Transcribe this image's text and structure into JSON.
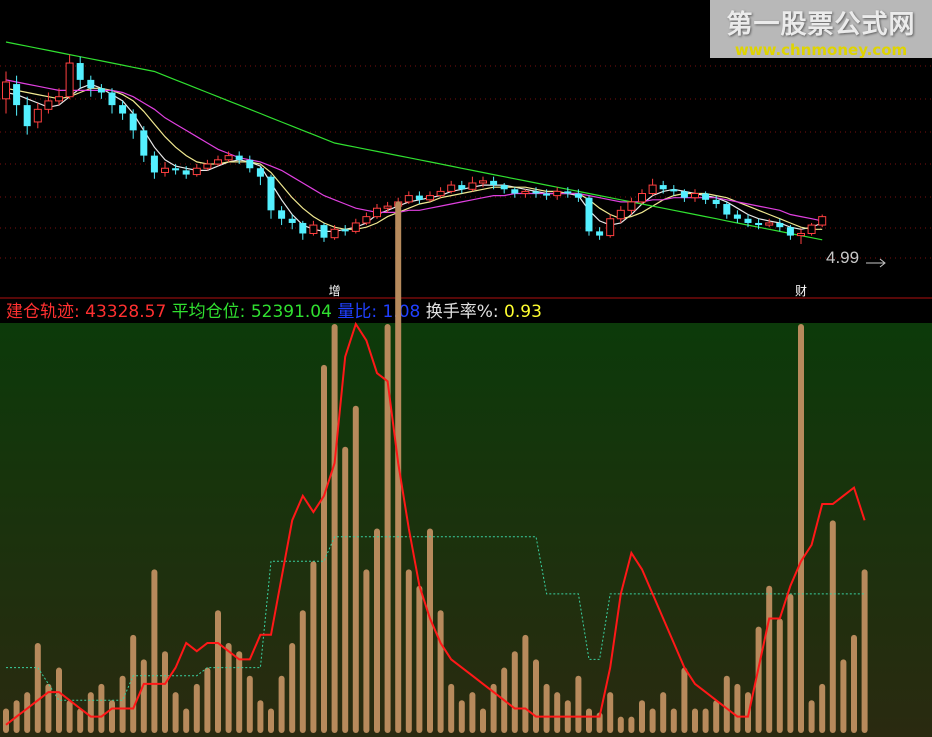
{
  "watermark": {
    "title": "第一股票公式网",
    "url": "www.chnmoney.com"
  },
  "colors": {
    "bg": "#000000",
    "grid": "#7a1010",
    "up": "#ff4040",
    "down": "#54f0ff",
    "ma_white": "#e8e8e8",
    "ma_yellow": "#f0e890",
    "ma_magenta": "#e040e0",
    "ma_green": "#30e030",
    "vol_bar": "#b78a5c",
    "red_line": "#ff1818",
    "dot_line": "#3ad0a0",
    "lower_bg_top": "#0c3a0a",
    "lower_bg_bottom": "#2a2a10"
  },
  "indicator_bar": [
    {
      "label": "建仓轨迹:",
      "value": "43328.57",
      "label_color": "#ff3030",
      "value_color": "#ff3030"
    },
    {
      "label": "平均仓位:",
      "value": "52391.04",
      "label_color": "#30e030",
      "value_color": "#30e030"
    },
    {
      "label": "量比:",
      "value": "1.08",
      "label_color": "#2040ff",
      "value_color": "#2040ff"
    },
    {
      "label": "换手率%:",
      "value": "0.93",
      "label_color": "#e0e0e0",
      "value_color": "#ffff30"
    }
  ],
  "chart_data": [
    {
      "type": "candlestick",
      "price_annotation": "4.99",
      "event_markers": [
        {
          "index": 31,
          "label": "增"
        },
        {
          "index": 75,
          "label": "财"
        }
      ],
      "candles": [
        [
          5.55,
          5.63,
          5.68,
          5.48
        ],
        [
          5.62,
          5.52,
          5.66,
          5.47
        ],
        [
          5.52,
          5.42,
          5.56,
          5.38
        ],
        [
          5.44,
          5.5,
          5.53,
          5.41
        ],
        [
          5.5,
          5.54,
          5.58,
          5.48
        ],
        [
          5.54,
          5.56,
          5.6,
          5.52
        ],
        [
          5.56,
          5.72,
          5.76,
          5.55
        ],
        [
          5.72,
          5.64,
          5.75,
          5.6
        ],
        [
          5.64,
          5.6,
          5.66,
          5.56
        ],
        [
          5.6,
          5.58,
          5.62,
          5.55
        ],
        [
          5.58,
          5.52,
          5.6,
          5.48
        ],
        [
          5.52,
          5.48,
          5.54,
          5.45
        ],
        [
          5.48,
          5.4,
          5.5,
          5.36
        ],
        [
          5.4,
          5.28,
          5.42,
          5.25
        ],
        [
          5.28,
          5.2,
          5.3,
          5.17
        ],
        [
          5.2,
          5.22,
          5.25,
          5.18
        ],
        [
          5.22,
          5.21,
          5.24,
          5.19
        ],
        [
          5.21,
          5.19,
          5.23,
          5.17
        ],
        [
          5.19,
          5.22,
          5.24,
          5.18
        ],
        [
          5.22,
          5.24,
          5.26,
          5.21
        ],
        [
          5.24,
          5.26,
          5.28,
          5.23
        ],
        [
          5.26,
          5.28,
          5.3,
          5.25
        ],
        [
          5.28,
          5.26,
          5.3,
          5.24
        ],
        [
          5.26,
          5.22,
          5.28,
          5.2
        ],
        [
          5.22,
          5.18,
          5.23,
          5.14
        ],
        [
          5.18,
          5.02,
          5.19,
          4.98
        ],
        [
          5.02,
          4.98,
          5.04,
          4.95
        ],
        [
          4.98,
          4.96,
          5.0,
          4.93
        ],
        [
          4.96,
          4.91,
          4.97,
          4.88
        ],
        [
          4.91,
          4.95,
          4.97,
          4.9
        ],
        [
          4.95,
          4.89,
          4.96,
          4.87
        ],
        [
          4.89,
          4.93,
          4.95,
          4.88
        ],
        [
          4.93,
          4.92,
          4.95,
          4.9
        ],
        [
          4.92,
          4.96,
          4.98,
          4.91
        ],
        [
          4.96,
          4.99,
          5.01,
          4.95
        ],
        [
          4.99,
          5.03,
          5.05,
          4.98
        ],
        [
          5.03,
          5.04,
          5.06,
          5.01
        ],
        [
          5.04,
          5.06,
          5.08,
          5.03
        ],
        [
          5.06,
          5.09,
          5.11,
          5.05
        ],
        [
          5.09,
          5.07,
          5.11,
          5.05
        ],
        [
          5.07,
          5.09,
          5.11,
          5.06
        ],
        [
          5.09,
          5.11,
          5.13,
          5.08
        ],
        [
          5.11,
          5.14,
          5.16,
          5.1
        ],
        [
          5.14,
          5.12,
          5.16,
          5.1
        ],
        [
          5.12,
          5.15,
          5.18,
          5.11
        ],
        [
          5.15,
          5.16,
          5.18,
          5.13
        ],
        [
          5.16,
          5.14,
          5.18,
          5.12
        ],
        [
          5.14,
          5.12,
          5.15,
          5.1
        ],
        [
          5.12,
          5.1,
          5.13,
          5.08
        ],
        [
          5.1,
          5.11,
          5.12,
          5.08
        ],
        [
          5.11,
          5.1,
          5.13,
          5.08
        ],
        [
          5.1,
          5.09,
          5.12,
          5.07
        ],
        [
          5.09,
          5.11,
          5.13,
          5.07
        ],
        [
          5.11,
          5.1,
          5.13,
          5.08
        ],
        [
          5.1,
          5.08,
          5.12,
          5.06
        ],
        [
          5.08,
          4.92,
          5.09,
          4.9
        ],
        [
          4.92,
          4.9,
          4.94,
          4.88
        ],
        [
          4.9,
          4.98,
          5.0,
          4.89
        ],
        [
          4.98,
          5.02,
          5.04,
          4.96
        ],
        [
          5.02,
          5.06,
          5.08,
          5.0
        ],
        [
          5.06,
          5.1,
          5.12,
          5.05
        ],
        [
          5.1,
          5.14,
          5.17,
          5.09
        ],
        [
          5.14,
          5.12,
          5.16,
          5.1
        ],
        [
          5.12,
          5.11,
          5.14,
          5.09
        ],
        [
          5.11,
          5.08,
          5.12,
          5.06
        ],
        [
          5.08,
          5.1,
          5.12,
          5.06
        ],
        [
          5.1,
          5.07,
          5.11,
          5.05
        ],
        [
          5.07,
          5.05,
          5.09,
          5.03
        ],
        [
          5.05,
          5.0,
          5.06,
          4.98
        ],
        [
          5.0,
          4.98,
          5.02,
          4.96
        ],
        [
          4.98,
          4.96,
          5.0,
          4.94
        ],
        [
          4.96,
          4.95,
          4.98,
          4.93
        ],
        [
          4.95,
          4.96,
          4.98,
          4.94
        ],
        [
          4.96,
          4.94,
          4.98,
          4.92
        ],
        [
          4.94,
          4.9,
          4.95,
          4.88
        ],
        [
          4.9,
          4.91,
          4.93,
          4.86
        ],
        [
          4.91,
          4.95,
          4.96,
          4.9
        ],
        [
          4.95,
          4.99,
          5.0,
          4.94
        ]
      ],
      "moving_averages": [
        {
          "color": "#e8e8e8",
          "values": [
            5.58,
            5.57,
            5.55,
            5.53,
            5.51,
            5.52,
            5.56,
            5.6,
            5.62,
            5.6,
            5.57,
            5.54,
            5.48,
            5.4,
            5.32,
            5.26,
            5.23,
            5.22,
            5.21,
            5.21,
            5.23,
            5.25,
            5.26,
            5.25,
            5.23,
            5.15,
            5.07,
            5.0,
            4.95,
            4.93,
            4.92,
            4.92,
            4.93,
            4.94,
            4.96,
            5.0,
            5.02,
            5.04,
            5.06,
            5.07,
            5.08,
            5.09,
            5.11,
            5.12,
            5.13,
            5.14,
            5.14,
            5.14,
            5.13,
            5.12,
            5.11,
            5.1,
            5.1,
            5.1,
            5.09,
            5.02,
            4.97,
            4.95,
            4.96,
            5.0,
            5.05,
            5.09,
            5.11,
            5.12,
            5.11,
            5.1,
            5.09,
            5.08,
            5.06,
            5.03,
            5.0,
            4.98,
            4.97,
            4.96,
            4.94,
            4.93,
            4.94,
            4.96
          ]
        },
        {
          "color": "#f0e890",
          "values": [
            5.6,
            5.59,
            5.58,
            5.57,
            5.56,
            5.55,
            5.56,
            5.58,
            5.6,
            5.6,
            5.59,
            5.57,
            5.54,
            5.49,
            5.43,
            5.37,
            5.32,
            5.28,
            5.25,
            5.24,
            5.24,
            5.25,
            5.25,
            5.25,
            5.24,
            5.2,
            5.14,
            5.08,
            5.03,
            4.99,
            4.96,
            4.94,
            4.93,
            4.93,
            4.94,
            4.96,
            4.99,
            5.01,
            5.03,
            5.05,
            5.06,
            5.08,
            5.09,
            5.1,
            5.11,
            5.12,
            5.13,
            5.13,
            5.13,
            5.13,
            5.12,
            5.11,
            5.11,
            5.1,
            5.1,
            5.07,
            5.03,
            5.0,
            4.98,
            4.99,
            5.01,
            5.04,
            5.07,
            5.09,
            5.1,
            5.1,
            5.1,
            5.09,
            5.08,
            5.06,
            5.04,
            5.02,
            5.0,
            4.98,
            4.96,
            4.94,
            4.93,
            4.93
          ]
        },
        {
          "color": "#e040e0",
          "values": [
            5.64,
            5.63,
            5.62,
            5.61,
            5.6,
            5.59,
            5.59,
            5.59,
            5.59,
            5.59,
            5.59,
            5.58,
            5.56,
            5.53,
            5.5,
            5.46,
            5.43,
            5.4,
            5.37,
            5.34,
            5.31,
            5.29,
            5.27,
            5.26,
            5.25,
            5.23,
            5.21,
            5.18,
            5.15,
            5.12,
            5.09,
            5.07,
            5.05,
            5.03,
            5.02,
            5.01,
            5.01,
            5.01,
            5.02,
            5.02,
            5.03,
            5.04,
            5.05,
            5.06,
            5.07,
            5.08,
            5.09,
            5.09,
            5.1,
            5.1,
            5.1,
            5.1,
            5.1,
            5.1,
            5.1,
            5.09,
            5.08,
            5.07,
            5.06,
            5.06,
            5.06,
            5.07,
            5.07,
            5.08,
            5.08,
            5.08,
            5.08,
            5.08,
            5.07,
            5.06,
            5.05,
            5.04,
            5.03,
            5.02,
            5.0,
            4.99,
            4.98,
            4.97
          ]
        },
        {
          "color": "#30e030",
          "values": [
            5.82,
            5.81,
            5.8,
            5.79,
            5.78,
            5.77,
            5.76,
            5.75,
            5.74,
            5.73,
            5.72,
            5.71,
            5.7,
            5.69,
            5.68,
            5.66,
            5.64,
            5.62,
            5.6,
            5.58,
            5.56,
            5.54,
            5.52,
            5.5,
            5.48,
            5.46,
            5.44,
            5.42,
            5.4,
            5.38,
            5.36,
            5.34,
            5.33,
            5.32,
            5.31,
            5.3,
            5.29,
            5.28,
            5.27,
            5.26,
            5.25,
            5.24,
            5.23,
            5.22,
            5.21,
            5.2,
            5.19,
            5.18,
            5.17,
            5.16,
            5.15,
            5.14,
            5.13,
            5.12,
            5.11,
            5.1,
            5.09,
            5.08,
            5.07,
            5.06,
            5.05,
            5.04,
            5.03,
            5.02,
            5.01,
            5.0,
            4.99,
            4.98,
            4.97,
            4.96,
            4.95,
            4.94,
            4.93,
            4.92,
            4.91,
            4.9,
            4.89,
            4.88
          ]
        }
      ]
    },
    {
      "type": "bar+line",
      "volume_bars": [
        6,
        8,
        10,
        22,
        12,
        16,
        8,
        6,
        10,
        12,
        8,
        14,
        24,
        18,
        40,
        20,
        10,
        6,
        12,
        16,
        30,
        22,
        20,
        14,
        8,
        6,
        14,
        22,
        30,
        42,
        90,
        100,
        70,
        80,
        40,
        50,
        100,
        130,
        40,
        36,
        50,
        30,
        12,
        8,
        10,
        6,
        12,
        16,
        20,
        24,
        18,
        12,
        10,
        8,
        14,
        6,
        5,
        10,
        4,
        4,
        8,
        6,
        10,
        6,
        16,
        6,
        6,
        8,
        14,
        12,
        10,
        26,
        36,
        28,
        34,
        100,
        8,
        12,
        52,
        18,
        24,
        40
      ],
      "red_line": [
        2,
        4,
        6,
        8,
        10,
        10,
        8,
        6,
        4,
        4,
        6,
        6,
        6,
        12,
        12,
        12,
        16,
        22,
        20,
        22,
        22,
        20,
        18,
        18,
        24,
        24,
        38,
        52,
        58,
        54,
        58,
        66,
        92,
        100,
        96,
        88,
        86,
        66,
        50,
        36,
        28,
        22,
        18,
        16,
        14,
        12,
        10,
        8,
        6,
        6,
        4,
        4,
        4,
        4,
        4,
        4,
        4,
        16,
        34,
        44,
        40,
        34,
        28,
        22,
        16,
        12,
        10,
        8,
        6,
        4,
        4,
        16,
        28,
        28,
        36,
        42,
        46,
        56,
        56,
        58,
        60,
        52
      ],
      "dotted_line": [
        16,
        16,
        16,
        16,
        12,
        8,
        8,
        8,
        8,
        8,
        8,
        8,
        14,
        14,
        14,
        14,
        14,
        14,
        14,
        16,
        16,
        16,
        16,
        16,
        16,
        42,
        42,
        42,
        42,
        42,
        42,
        48,
        48,
        48,
        48,
        48,
        48,
        48,
        48,
        48,
        48,
        48,
        48,
        48,
        48,
        48,
        48,
        48,
        48,
        48,
        48,
        34,
        34,
        34,
        34,
        18,
        18,
        34,
        34,
        34,
        34,
        34,
        34,
        34,
        34,
        34,
        34,
        34,
        34,
        34,
        34,
        34,
        34,
        34,
        34,
        34,
        34,
        34,
        34,
        34,
        34,
        34
      ]
    }
  ]
}
